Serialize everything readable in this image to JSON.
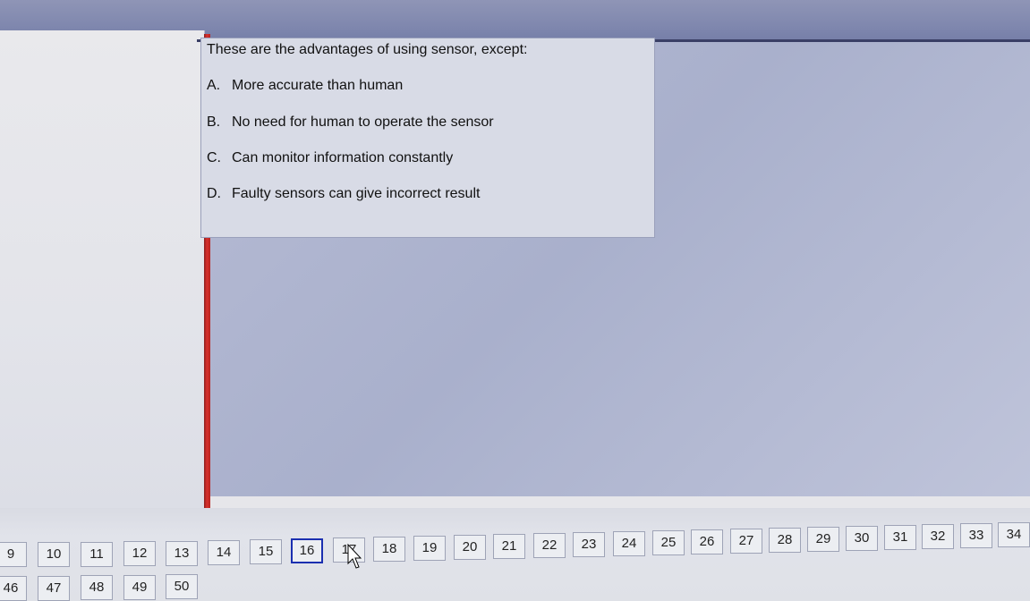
{
  "question": {
    "text": "These are the advantages of using sensor, except:",
    "options": [
      {
        "letter": "A.",
        "text": "More accurate than human"
      },
      {
        "letter": "B.",
        "text": "No need for human to operate the sensor"
      },
      {
        "letter": "C.",
        "text": "Can monitor information constantly"
      },
      {
        "letter": "D.",
        "text": "Faulty sensors can give incorrect result"
      }
    ]
  },
  "navigation": {
    "row1": [
      "9",
      "10",
      "11",
      "12",
      "13",
      "14",
      "15",
      "16",
      "17",
      "18",
      "19",
      "20",
      "21",
      "22",
      "23",
      "24",
      "25",
      "26",
      "27",
      "28",
      "29",
      "30",
      "31",
      "32",
      "33",
      "34"
    ],
    "row2": [
      "46",
      "47",
      "48",
      "49",
      "50"
    ],
    "current": "16"
  },
  "colors": {
    "accent_red": "#d8302c",
    "current_border": "#1b2fb0"
  }
}
